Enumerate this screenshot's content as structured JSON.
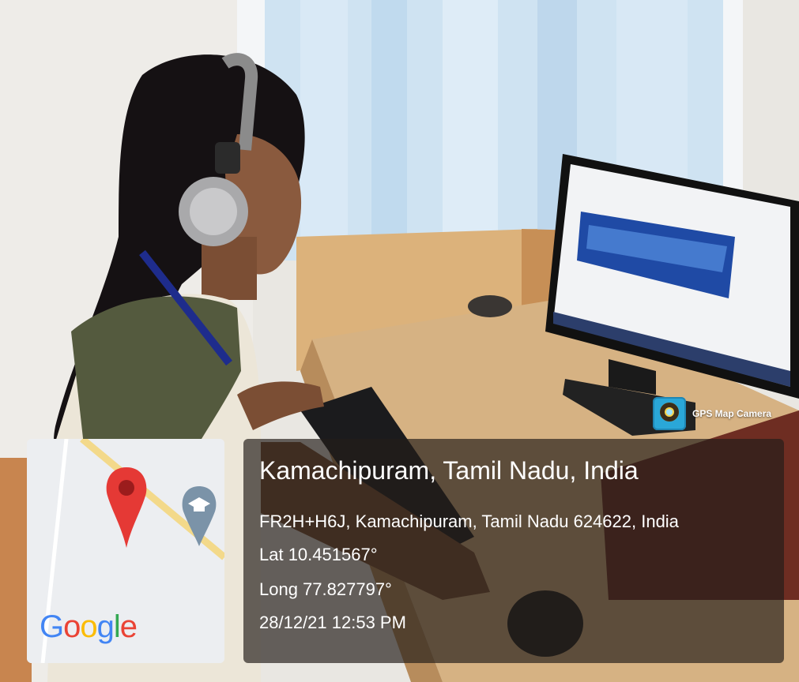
{
  "badge": {
    "label": "GPS Map Camera",
    "icon": "camera-lens-icon"
  },
  "location": {
    "title": "Kamachipuram, Tamil Nadu, India",
    "address": "FR2H+H6J, Kamachipuram, Tamil Nadu 624622, India",
    "latitude": "Lat 10.451567°",
    "longitude": "Long 77.827797°",
    "datetime": "28/12/21 12:53 PM"
  },
  "map": {
    "icons": [
      "map-pin-icon",
      "graduation-cap-icon"
    ],
    "logo": "Google",
    "logo_colors": [
      "#4285F4",
      "#EA4335",
      "#FBBC05",
      "#4285F4",
      "#34A853",
      "#EA4335"
    ]
  },
  "colors": {
    "pin_red": "#e53935",
    "road_yellow": "#f3d98a",
    "overlay_bg": "#231e19"
  }
}
